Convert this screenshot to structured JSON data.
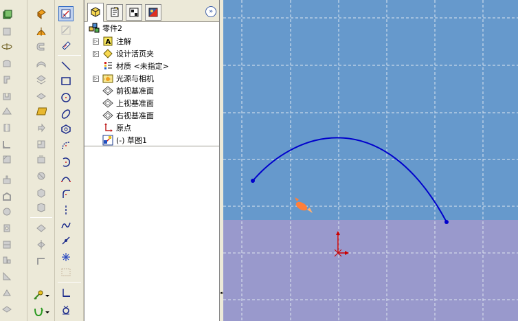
{
  "feature_tree": {
    "root": "零件2",
    "items": [
      {
        "label": "注解",
        "icon": "annotations-icon",
        "expandable": true
      },
      {
        "label": "设计活页夹",
        "icon": "design-binder-icon",
        "expandable": true
      },
      {
        "label": "材质 <未指定>",
        "icon": "material-icon",
        "expandable": false
      },
      {
        "label": "光源与相机",
        "icon": "lights-cameras-icon",
        "expandable": true
      },
      {
        "label": "前视基准面",
        "icon": "plane-icon",
        "expandable": false
      },
      {
        "label": "上视基准面",
        "icon": "plane-icon",
        "expandable": false
      },
      {
        "label": "右视基准面",
        "icon": "plane-icon",
        "expandable": false
      },
      {
        "label": "原点",
        "icon": "origin-icon",
        "expandable": false
      },
      {
        "label": "(-) 草图1",
        "icon": "sketch-icon",
        "expandable": false
      }
    ]
  },
  "fm_tabs": [
    {
      "name": "feature-manager-tab",
      "active": true
    },
    {
      "name": "property-manager-tab",
      "active": false
    },
    {
      "name": "configuration-manager-tab",
      "active": false
    },
    {
      "name": "display-manager-tab",
      "active": false
    }
  ],
  "expand_label": "»",
  "splitter_grip": "◂◂",
  "colors": {
    "sky": "#6699cc",
    "ground": "#9999cc",
    "grid": "#dfe6f0",
    "arc": "#0000cc",
    "origin": "#cc0000",
    "panel_bg": "#ece9d8"
  }
}
